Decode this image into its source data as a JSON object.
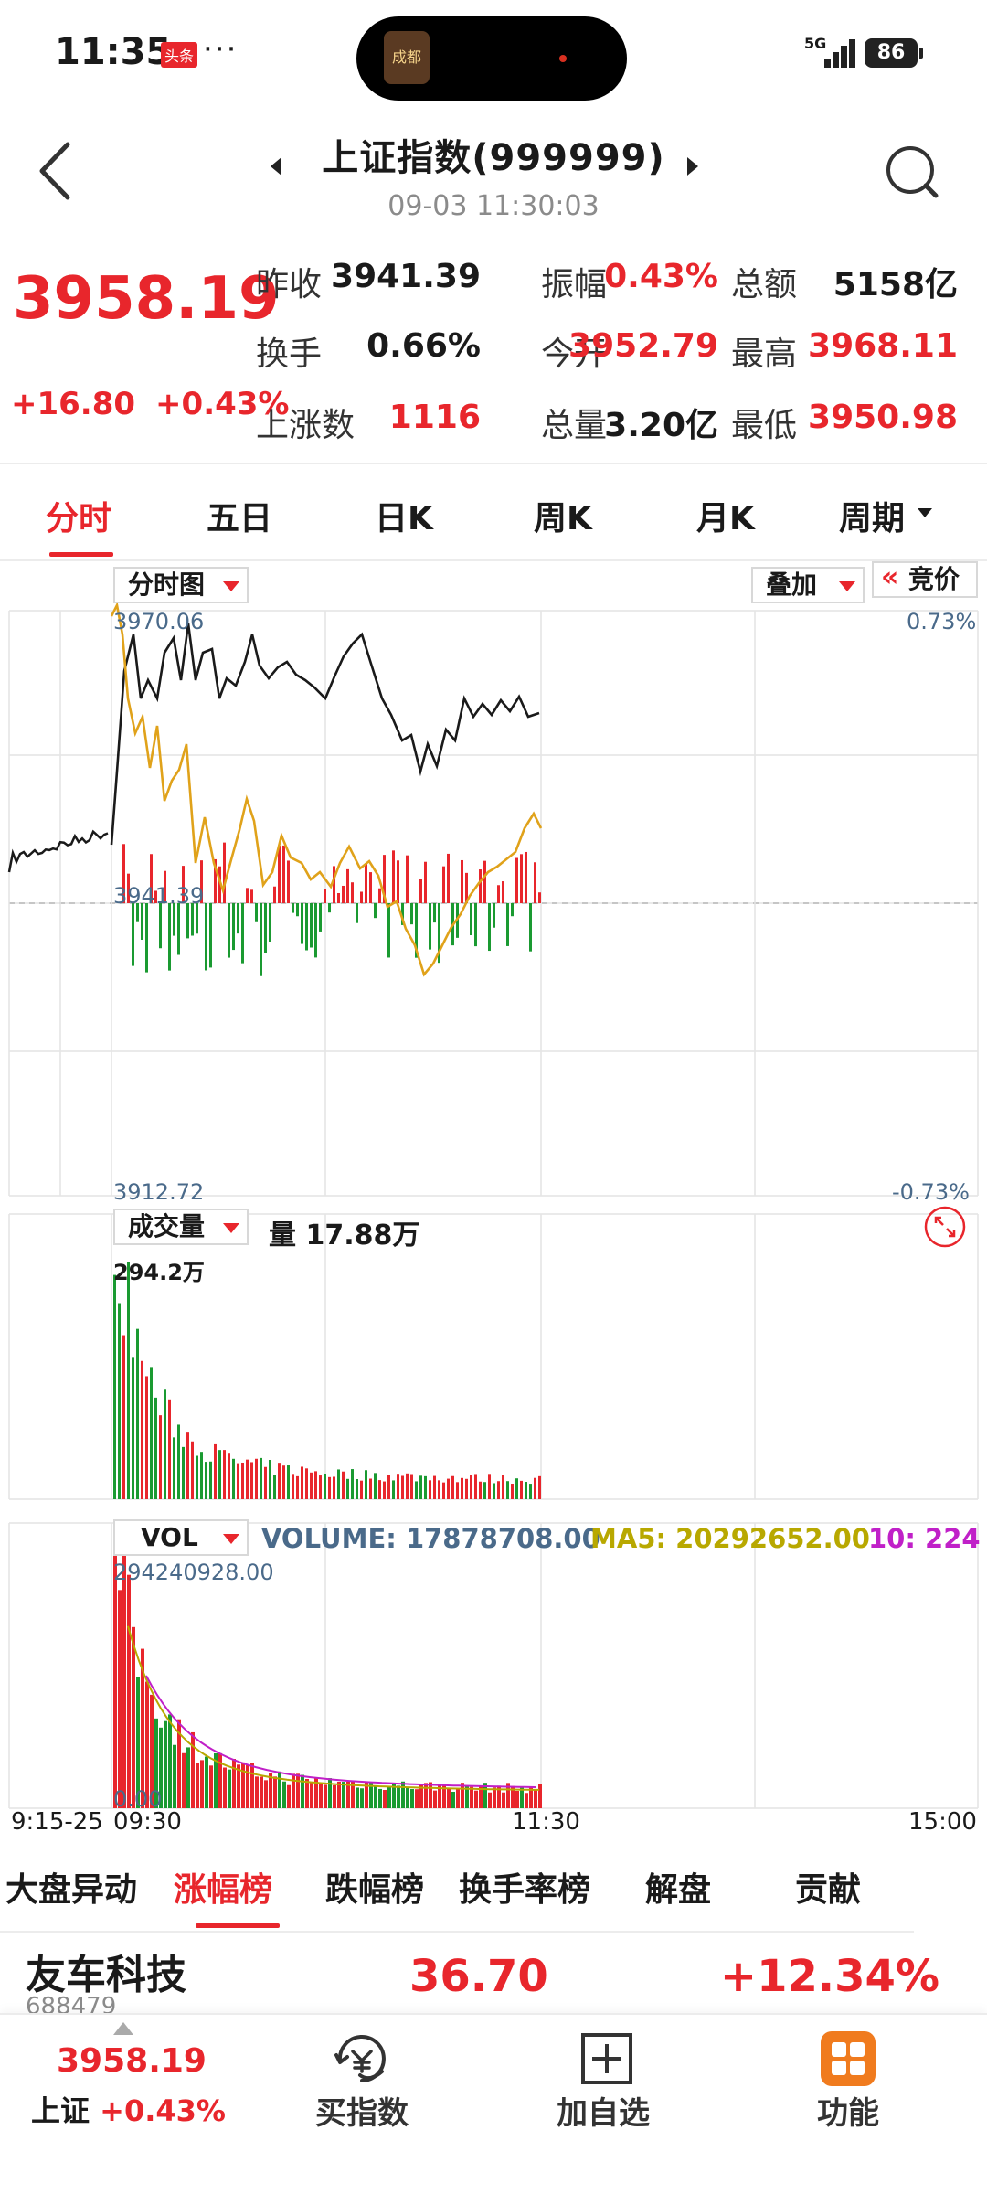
{
  "status_bar": {
    "time": "11:35",
    "news_badge": "头条",
    "more": "···",
    "island_thumb_text": "成都",
    "network": "5G",
    "battery": "86"
  },
  "header": {
    "title": "上证指数(999999)",
    "datetime": "09-03 11:30:03"
  },
  "quote": {
    "price": "3958.19",
    "change": "+16.80",
    "change_pct": "+0.43%",
    "stats": [
      {
        "label": "昨收",
        "value": "3941.39",
        "color": "#1a1a1a"
      },
      {
        "label": "振幅",
        "value": "0.43%",
        "color": "#e8262c"
      },
      {
        "label": "总额",
        "value": "5158亿",
        "color": "#1a1a1a"
      },
      {
        "label": "换手",
        "value": "0.66%",
        "color": "#1a1a1a"
      },
      {
        "label": "今开",
        "value": "3952.79",
        "color": "#e8262c"
      },
      {
        "label": "最高",
        "value": "3968.11",
        "color": "#e8262c"
      },
      {
        "label": "上涨数",
        "value": "1116",
        "color": "#e8262c"
      },
      {
        "label": "总量",
        "value": "3.20亿",
        "color": "#1a1a1a"
      },
      {
        "label": "最低",
        "value": "3950.98",
        "color": "#e8262c"
      }
    ]
  },
  "period_tabs": [
    "分时",
    "五日",
    "日K",
    "周K",
    "月K",
    "周期"
  ],
  "intraday": {
    "selector": "分时图",
    "overlay": "叠加",
    "bid_button": "竞价",
    "max_label": "3970.06",
    "mid_label": "3941.39",
    "min_label": "3912.72",
    "max_pct": "0.73%",
    "min_pct": "-0.73%"
  },
  "volume_panel": {
    "selector": "成交量",
    "current": "量 17.88万",
    "max_label": "294.2万"
  },
  "vol_panel": {
    "selector": "VOL",
    "volume_text": "VOLUME: 17878708.00",
    "ma5_text": "MA5: 20292652.00",
    "ma10_text": "10: 224",
    "max_label": "294240928.00",
    "min_label": "0.00"
  },
  "time_axis": {
    "preopen": "9:15-25",
    "open": "09:30",
    "midday": "11:30",
    "close": "15:00"
  },
  "board_tabs": [
    "大盘异动",
    "涨幅榜",
    "跌幅榜",
    "换手率榜",
    "解盘",
    "贡献"
  ],
  "top_stock": {
    "name": "友车科技",
    "code": "688479",
    "price": "36.70",
    "change_pct": "+12.34%"
  },
  "bottom_nav": {
    "index_price": "3958.19",
    "index_name": "上证",
    "index_pct": "+0.43%",
    "buy_label": "买指数",
    "add_label": "加自选",
    "func_label": "功能"
  },
  "colors": {
    "up": "#e8262c",
    "down": "#1a9a31",
    "price_line": "#1a1a1a",
    "avg_line": "#e0a21a",
    "ma10": "#c020c8"
  }
}
